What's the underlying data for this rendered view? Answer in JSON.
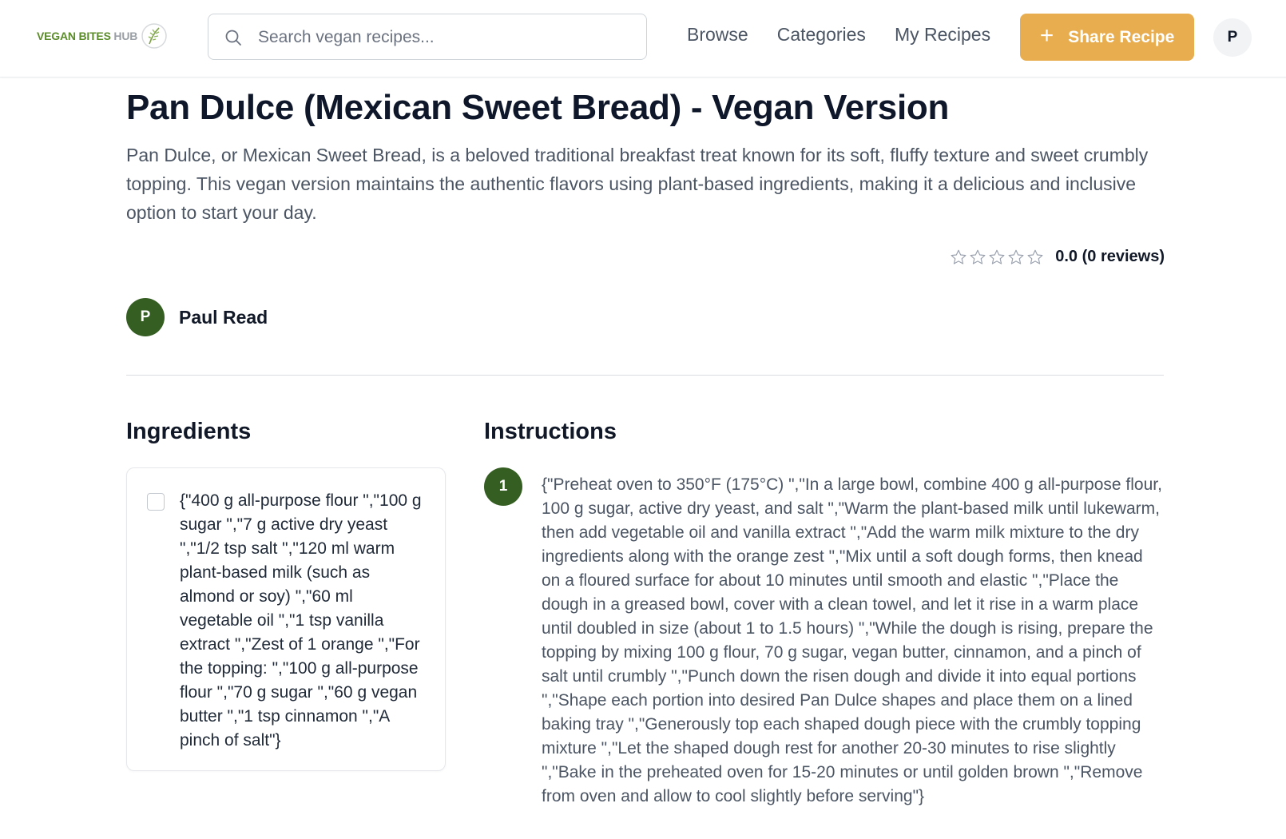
{
  "header": {
    "logo_text": "VEGAN BITES",
    "logo_hub": "HUB",
    "search_placeholder": "Search vegan recipes...",
    "nav": [
      "Browse",
      "Categories",
      "My Recipes"
    ],
    "share_label": "Share Recipe",
    "user_initial": "P"
  },
  "recipe": {
    "title": "Pan Dulce (Mexican Sweet Bread) - Vegan Version",
    "description": "Pan Dulce, or Mexican Sweet Bread, is a beloved traditional breakfast treat known for its soft, fluffy texture and sweet crumbly topping. This vegan version maintains the authentic flavors using plant-based ingredients, making it a delicious and inclusive option to start your day.",
    "rating_text": "0.0 (0 reviews)",
    "rating_value": 0,
    "rating_max": 5,
    "author_initial": "P",
    "author_name": "Paul Read"
  },
  "ingredients": {
    "title": "Ingredients",
    "items": [
      "{\"400 g all-purpose flour \",\"100 g sugar \",\"7 g active dry yeast \",\"1/2 tsp salt \",\"120 ml warm plant-based milk (such as almond or soy) \",\"60 ml vegetable oil \",\"1 tsp vanilla extract \",\"Zest of 1 orange \",\"For the topping: \",\"100 g all-purpose flour \",\"70 g sugar \",\"60 g vegan butter \",\"1 tsp cinnamon \",\"A pinch of salt\"}"
    ]
  },
  "instructions": {
    "title": "Instructions",
    "steps": [
      {
        "number": "1",
        "text": "{\"Preheat oven to 350°F (175°C) \",\"In a large bowl, combine 400 g all-purpose flour, 100 g sugar, active dry yeast, and salt \",\"Warm the plant-based milk until lukewarm, then add vegetable oil and vanilla extract \",\"Add the warm milk mixture to the dry ingredients along with the orange zest \",\"Mix until a soft dough forms, then knead on a floured surface for about 10 minutes until smooth and elastic \",\"Place the dough in a greased bowl, cover with a clean towel, and let it rise in a warm place until doubled in size (about 1 to 1.5 hours) \",\"While the dough is rising, prepare the topping by mixing 100 g flour, 70 g sugar, vegan butter, cinnamon, and a pinch of salt until crumbly \",\"Punch down the risen dough and divide it into equal portions \",\"Shape each portion into desired Pan Dulce shapes and place them on a lined baking tray \",\"Generously top each shaped dough piece with the crumbly topping mixture \",\"Let the shaped dough rest for another 20-30 minutes to rise slightly \",\"Bake in the preheated oven for 15-20 minutes or until golden brown \",\"Remove from oven and allow to cool slightly before serving\"}"
      }
    ]
  },
  "colors": {
    "brand_green": "#355e23",
    "accent_orange": "#e8ad4f"
  }
}
